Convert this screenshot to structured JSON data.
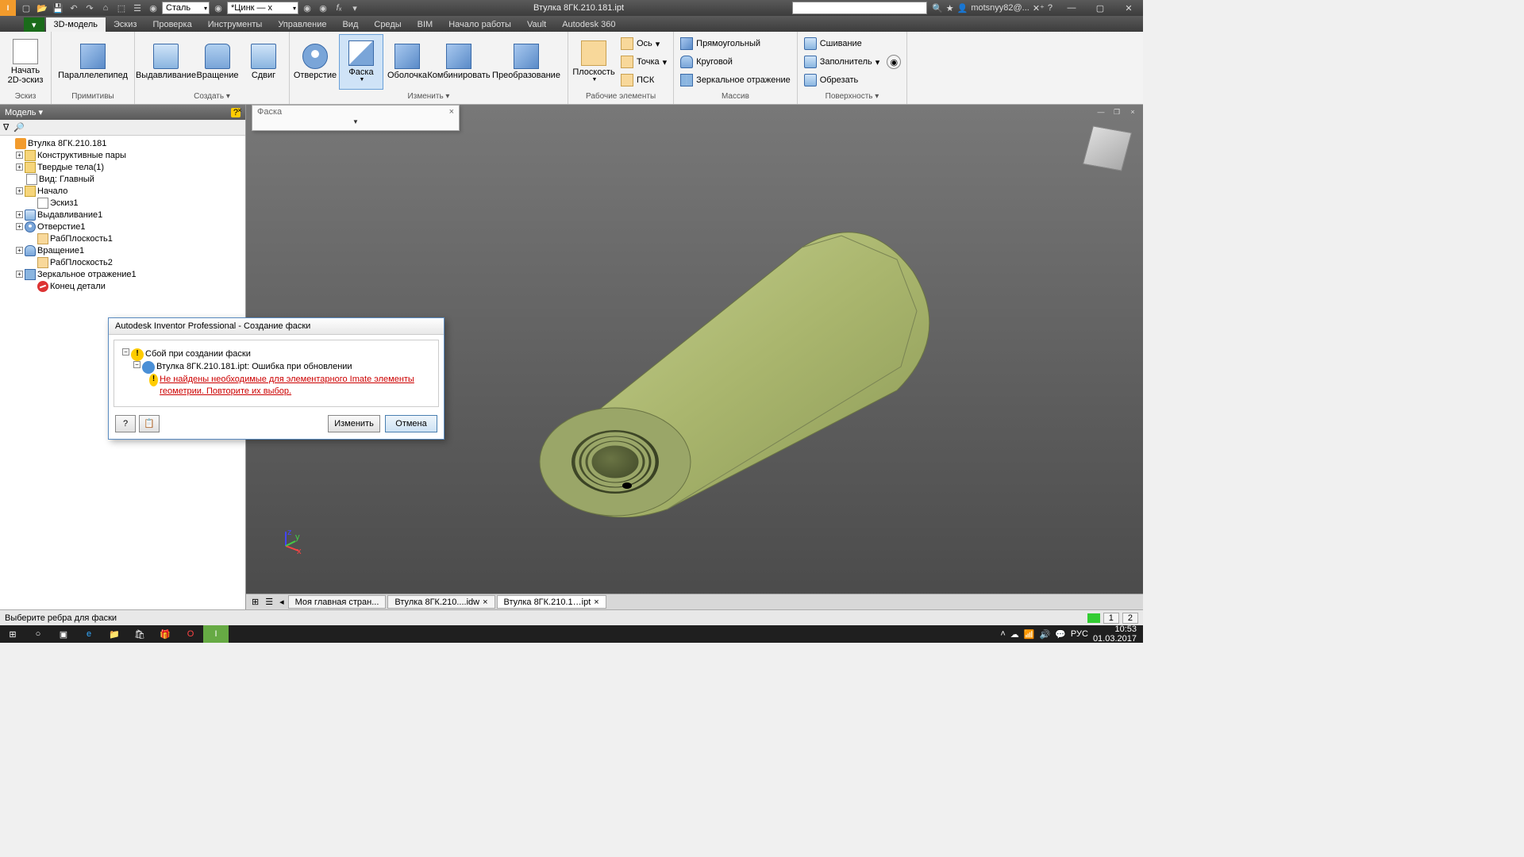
{
  "title": "Втулка 8ГК.210.181.ipt",
  "qat_material1": "Сталь",
  "qat_material2": "*Цинк — х",
  "user": "motsnyy82@...",
  "tabs": [
    "3D-модель",
    "Эскиз",
    "Проверка",
    "Инструменты",
    "Управление",
    "Вид",
    "Среды",
    "BIM",
    "Начало работы",
    "Vault",
    "Autodesk 360"
  ],
  "ribbon": {
    "sketch": {
      "btn": "Начать\n2D-эскиз",
      "title": "Эскиз"
    },
    "prim": {
      "btn": "Параллелепипед",
      "title": "Примитивы"
    },
    "create": {
      "b1": "Выдавливание",
      "b2": "Вращение",
      "b3": "Сдвиг",
      "title": "Создать ▾"
    },
    "modify": {
      "b1": "Отверстие",
      "b2": "Фаска",
      "b3": "Оболочка",
      "b4": "Комбинировать",
      "b5": "Преобразование",
      "title": "Изменить ▾"
    },
    "work": {
      "b": "Плоскость",
      "s1": "Ось",
      "s2": "Точка",
      "s3": "ПСК",
      "title": "Рабочие элементы"
    },
    "array": {
      "s1": "Прямоугольный",
      "s2": "Круговой",
      "s3": "Зеркальное отражение",
      "title": "Массив"
    },
    "surf": {
      "s1": "Сшивание",
      "s2": "Заполнитель",
      "s3": "Обрезать",
      "title": "Поверхность ▾"
    }
  },
  "browser": {
    "title": "Модель ▾",
    "items": [
      {
        "exp": "",
        "ico": "i-part",
        "label": "Втулка 8ГК.210.181",
        "ind": 0
      },
      {
        "exp": "+",
        "ico": "i-folder",
        "label": "Конструктивные пары",
        "ind": 1
      },
      {
        "exp": "+",
        "ico": "i-folder",
        "label": "Твердые тела(1)",
        "ind": 1
      },
      {
        "exp": "",
        "ico": "i-sketch",
        "label": "Вид: Главный",
        "ind": 1
      },
      {
        "exp": "+",
        "ico": "i-folder",
        "label": "Начало",
        "ind": 1
      },
      {
        "exp": "",
        "ico": "i-sketch",
        "label": "Эскиз1",
        "ind": 2
      },
      {
        "exp": "+",
        "ico": "i-ext",
        "label": "Выдавливание1",
        "ind": 1
      },
      {
        "exp": "+",
        "ico": "i-hole",
        "label": "Отверстие1",
        "ind": 1
      },
      {
        "exp": "",
        "ico": "i-plane",
        "label": "РабПлоскость1",
        "ind": 2
      },
      {
        "exp": "+",
        "ico": "i-cyl",
        "label": "Вращение1",
        "ind": 1
      },
      {
        "exp": "",
        "ico": "i-plane",
        "label": "РабПлоскость2",
        "ind": 2
      },
      {
        "exp": "+",
        "ico": "i-mirror",
        "label": "Зеркальное отражение1",
        "ind": 1
      },
      {
        "exp": "",
        "ico": "i-end",
        "label": "Конец детали",
        "ind": 2
      }
    ]
  },
  "mini_dialog": {
    "title": "Фаска"
  },
  "error": {
    "title": "Autodesk Inventor Professional - Создание фаски",
    "l1": "Сбой при создании фаски",
    "l2": "Втулка 8ГК.210.181.ipt: Ошибка при обновлении",
    "l3": "Не найдены необходимые для элементарного Imate элементы геометрии. Повторите их выбор.",
    "edit": "Изменить",
    "cancel": "Отмена"
  },
  "doctabs": [
    "Моя главная стран...",
    "Втулка 8ГК.210....idw",
    "Втулка 8ГК.210.1…ipt"
  ],
  "status": {
    "msg": "Выберите ребра для фаски",
    "n1": "1",
    "n2": "2"
  },
  "taskbar": {
    "lang": "РУС",
    "time": "10:53",
    "date": "01.03.2017"
  }
}
